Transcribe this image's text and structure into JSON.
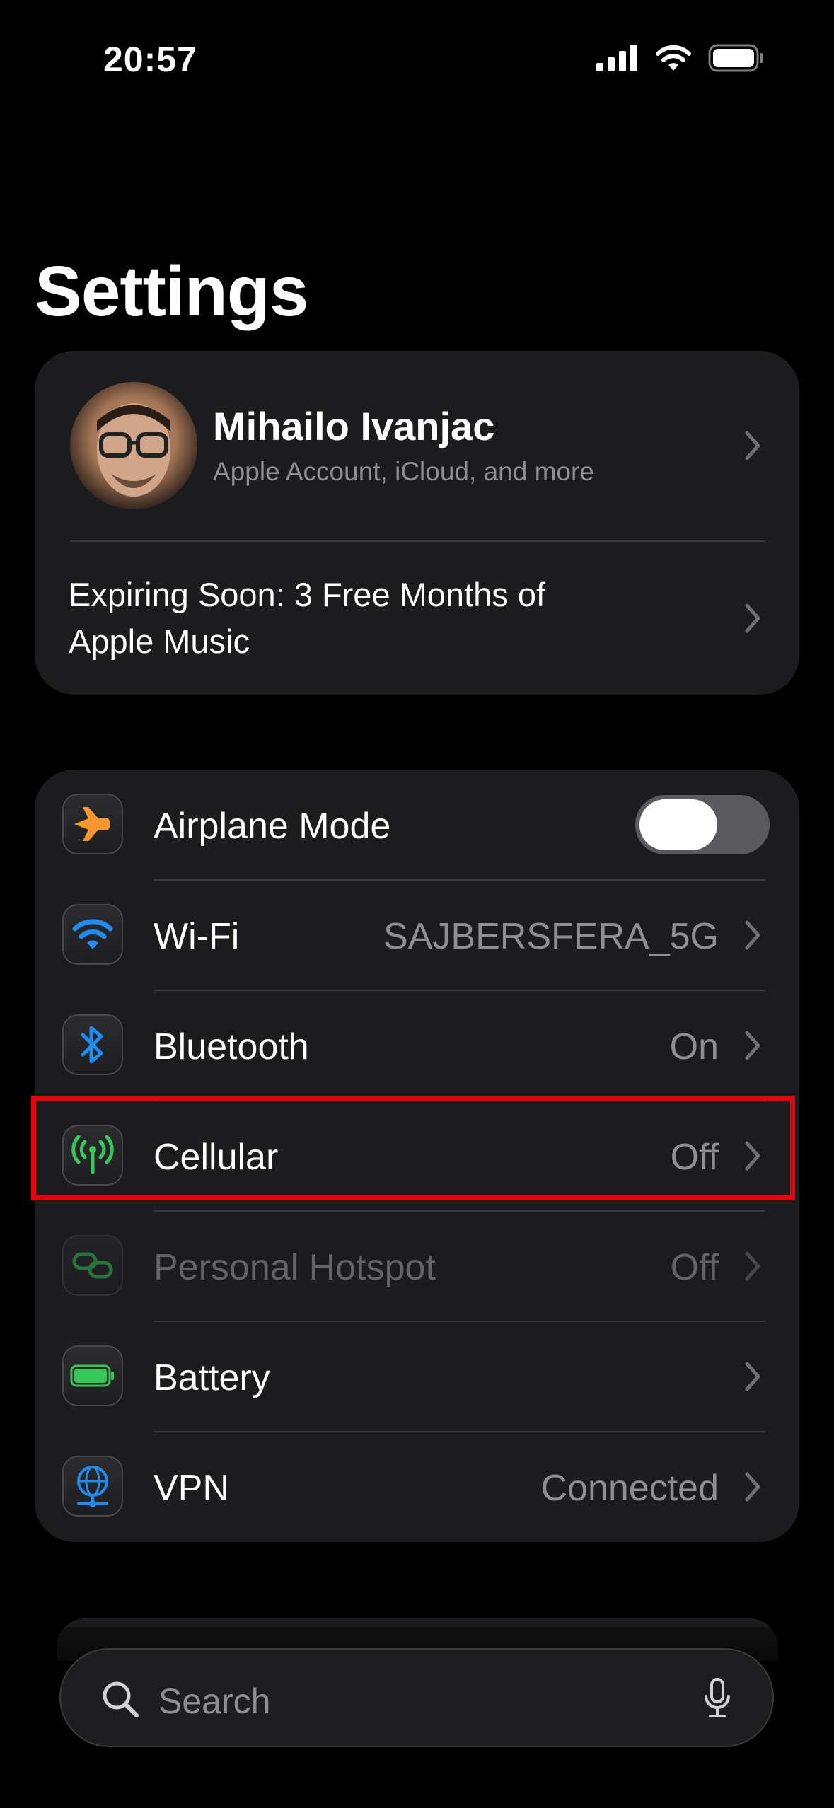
{
  "status_bar": {
    "time": "20:57"
  },
  "title": "Settings",
  "account": {
    "name": "Mihailo Ivanjac",
    "subtitle": "Apple Account, iCloud, and more",
    "promo": "Expiring Soon: 3 Free Months of Apple Music"
  },
  "settings_rows": [
    {
      "label": "Airplane Mode",
      "toggle_on": false
    },
    {
      "label": "Wi-Fi",
      "value": "SAJBERSFERA_5G"
    },
    {
      "label": "Bluetooth",
      "value": "On"
    },
    {
      "label": "Cellular",
      "value": "Off"
    },
    {
      "label": "Personal Hotspot",
      "value": "Off"
    },
    {
      "label": "Battery"
    },
    {
      "label": "VPN",
      "value": "Connected"
    }
  ],
  "search": {
    "placeholder": "Search"
  },
  "colors": {
    "airplane": "#f7952e",
    "wifi": "#1e8cf0",
    "bluetooth": "#1e8cf0",
    "cellular": "#35c759",
    "hotspot": "#35c759",
    "battery": "#35c759",
    "vpn": "#1e8cf0",
    "highlight": "#e8000b"
  }
}
